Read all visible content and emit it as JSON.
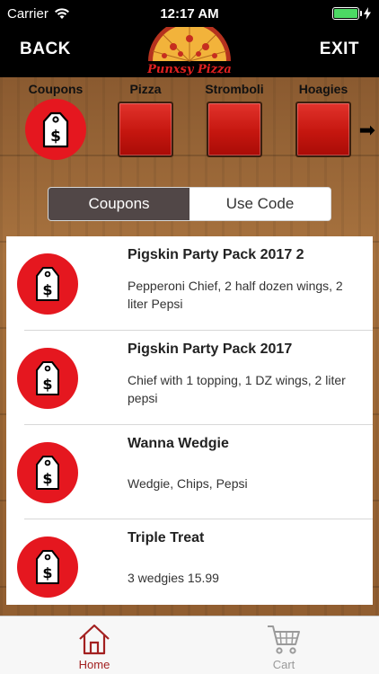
{
  "status_bar": {
    "carrier": "Carrier",
    "time": "12:17 AM",
    "wifi_icon": "wifi-icon",
    "battery_icon": "battery-icon",
    "charging_icon": "charging-bolt-icon"
  },
  "header": {
    "back_label": "BACK",
    "exit_label": "EXIT",
    "logo_text": "Punxsy Pizza",
    "logo_icon": "pizza-logo-icon"
  },
  "categories": [
    {
      "label": "Coupons",
      "icon": "price-tag-icon"
    },
    {
      "label": "Pizza"
    },
    {
      "label": "Stromboli"
    },
    {
      "label": "Hoagies"
    }
  ],
  "segment": {
    "tabs": [
      "Coupons",
      "Use Code"
    ],
    "selected": "Coupons"
  },
  "coupons": [
    {
      "title": "Pigskin Party Pack 2017 2",
      "description": "Pepperoni Chief, 2 half dozen wings, 2 liter Pepsi"
    },
    {
      "title": "Pigskin Party Pack 2017",
      "description": "Chief with 1 topping, 1 DZ wings, 2 liter pepsi"
    },
    {
      "title": "Wanna Wedgie",
      "description": "Wedgie, Chips, Pepsi"
    },
    {
      "title": "Triple Treat",
      "description": "3 wedgies 15.99"
    }
  ],
  "tabbar": {
    "home_label": "Home",
    "cart_label": "Cart",
    "active": "Home"
  },
  "colors": {
    "brand_red": "#e5171f",
    "segment_active": "#514747",
    "tab_active": "#a32020"
  }
}
